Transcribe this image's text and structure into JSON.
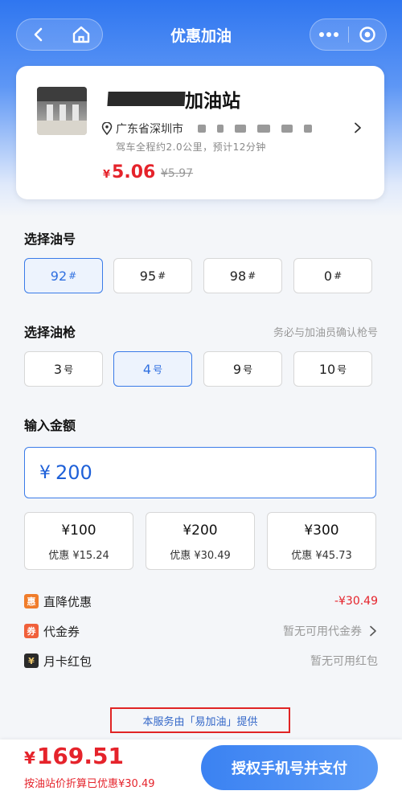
{
  "colors": {
    "brand": "#2f76f0",
    "accent_red": "#e5232b",
    "active_border": "#3a7be8"
  },
  "nav": {
    "title": "优惠加油",
    "back_icon": "chevron-left-icon",
    "home_icon": "home-icon",
    "more_icon": "more-dots-icon",
    "close_icon": "target-icon"
  },
  "station": {
    "name": "加油站",
    "address": "广东省深圳市",
    "distance": "驾车全程约2.0公里，预计12分钟",
    "price_currency": "¥",
    "price": "5.06",
    "original_price": "¥5.97"
  },
  "fuel": {
    "label": "选择油号",
    "options": [
      {
        "num": "92",
        "suffix": "#"
      },
      {
        "num": "95",
        "suffix": "#"
      },
      {
        "num": "98",
        "suffix": "#"
      },
      {
        "num": "0",
        "suffix": "#"
      }
    ],
    "selected": "92#"
  },
  "gun": {
    "label": "选择油枪",
    "hint": "务必与加油员确认枪号",
    "options": [
      {
        "num": "3",
        "suffix": "号"
      },
      {
        "num": "4",
        "suffix": "号"
      },
      {
        "num": "9",
        "suffix": "号"
      },
      {
        "num": "10",
        "suffix": "号"
      }
    ],
    "selected": "4号"
  },
  "amount": {
    "label": "输入金额",
    "currency": "¥",
    "value": "200"
  },
  "quick": [
    {
      "amount": "¥100",
      "discount": "优惠 ¥15.24"
    },
    {
      "amount": "¥200",
      "discount": "优惠 ¥30.49"
    },
    {
      "amount": "¥300",
      "discount": "优惠 ¥45.73"
    }
  ],
  "discounts": {
    "direct": {
      "badge": "惠",
      "label": "直降优惠",
      "value": "-¥30.49"
    },
    "voucher": {
      "badge": "券",
      "label": "代金券",
      "value": "暂无可用代金券"
    },
    "monthly": {
      "badge": "¥",
      "label": "月卡红包",
      "value": "暂无可用红包"
    }
  },
  "provider": "本服务由「易加油」提供",
  "footer": {
    "currency": "¥",
    "total": "169.51",
    "note": "按油站价折算已优惠¥30.49",
    "pay_button": "授权手机号并支付"
  }
}
